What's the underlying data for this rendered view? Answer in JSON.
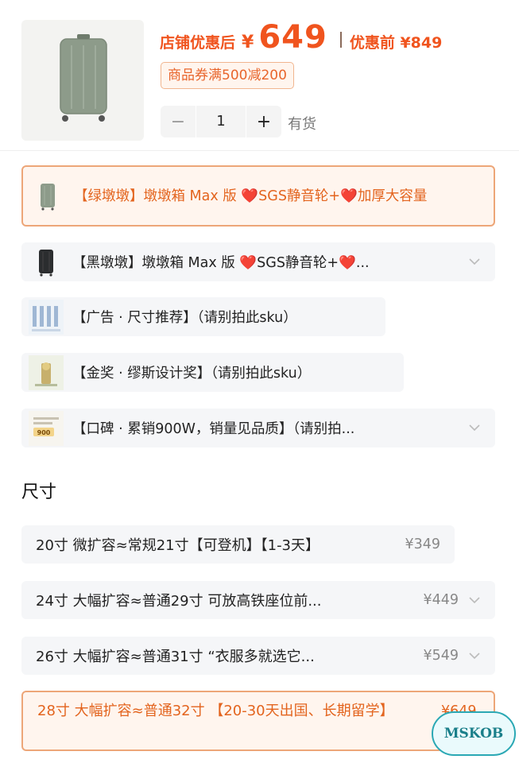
{
  "product": {
    "price_label": "店铺优惠后",
    "currency": "¥",
    "price": "649",
    "price_before": "优惠前 ¥849",
    "coupon": "商品券满500减200",
    "quantity": "1",
    "minus": "−",
    "plus": "+",
    "stock": "有货"
  },
  "variants": [
    {
      "label": "【绿墩墩】墩墩箱 Max 版 ❤️SGS静音轮+❤️加厚大容量",
      "selected": true,
      "thumb": "green-suitcase"
    },
    {
      "label": "【黑墩墩】墩墩箱 Max 版 ❤️SGS静音轮+❤️...",
      "selected": false,
      "thumb": "black-suitcase"
    },
    {
      "label": "【广告 · 尺寸推荐】（请别拍此sku）",
      "selected": false,
      "thumb": "size-chart"
    },
    {
      "label": "【金奖 · 缪斯设计奖】（请别拍此sku）",
      "selected": false,
      "thumb": "award"
    },
    {
      "label": "【口碑 · 累销900W，销量见品质】（请别拍...",
      "selected": false,
      "thumb": "reviews"
    }
  ],
  "variant_thumb_text": "900",
  "size_section_title": "尺寸",
  "sizes": [
    {
      "label": "20寸 微扩容≈常规21寸【可登机】【1-3天】",
      "price": "¥349",
      "selected": false
    },
    {
      "label": "24寸 大幅扩容≈普通29寸 可放高铁座位前...",
      "price": "¥449",
      "selected": false
    },
    {
      "label": "26寸 大幅扩容≈普通31寸 “衣服多就选它...",
      "price": "¥549",
      "selected": false
    },
    {
      "label": "28寸 大幅扩容≈普通32寸 【20-30天出国、长期留学】",
      "price": "¥649",
      "selected": true
    }
  ],
  "watermark": "MSKOB",
  "colors": {
    "accent": "#f0541e",
    "selected_border": "#eda678",
    "option_bg": "#f5f6f8"
  }
}
